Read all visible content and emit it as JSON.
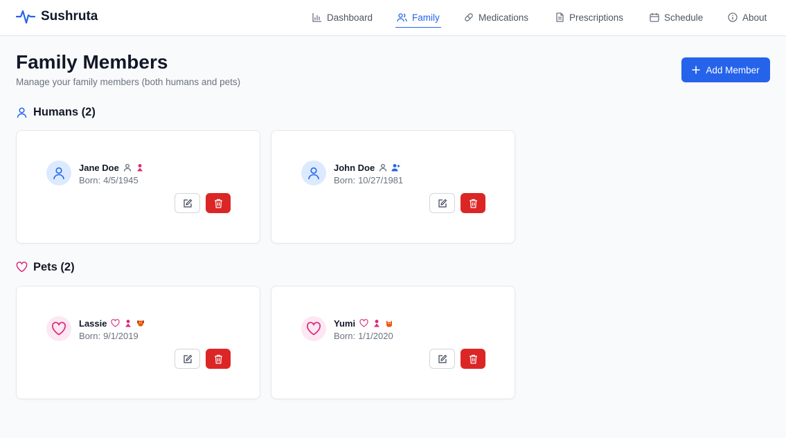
{
  "app": {
    "name": "Sushruta"
  },
  "nav": [
    {
      "label": "Dashboard",
      "icon": "bar-chart-icon"
    },
    {
      "label": "Family",
      "icon": "users-icon",
      "active": true
    },
    {
      "label": "Medications",
      "icon": "pill-icon"
    },
    {
      "label": "Prescriptions",
      "icon": "document-icon"
    },
    {
      "label": "Schedule",
      "icon": "calendar-icon"
    },
    {
      "label": "About",
      "icon": "info-icon"
    }
  ],
  "page": {
    "title": "Family Members",
    "subtitle": "Manage your family members (both humans and pets)",
    "add_button": "Add Member"
  },
  "sections": {
    "humans": {
      "title": "Humans (2)",
      "members": [
        {
          "name": "Jane Doe",
          "born_label": "Born:",
          "born": "4/5/1945",
          "gender": "female"
        },
        {
          "name": "John Doe",
          "born_label": "Born:",
          "born": "10/27/1981",
          "gender": "male"
        }
      ]
    },
    "pets": {
      "title": "Pets (2)",
      "members": [
        {
          "name": "Lassie",
          "born_label": "Born:",
          "born": "9/1/2019",
          "gender": "female",
          "species": "dog"
        },
        {
          "name": "Yumi",
          "born_label": "Born:",
          "born": "1/1/2020",
          "gender": "female",
          "species": "cat"
        }
      ]
    }
  },
  "colors": {
    "primary": "#2563eb",
    "danger": "#dc2626",
    "pet_accent": "#db2777",
    "female": "#db2777",
    "male": "#2563eb",
    "species": "#ea580c"
  }
}
